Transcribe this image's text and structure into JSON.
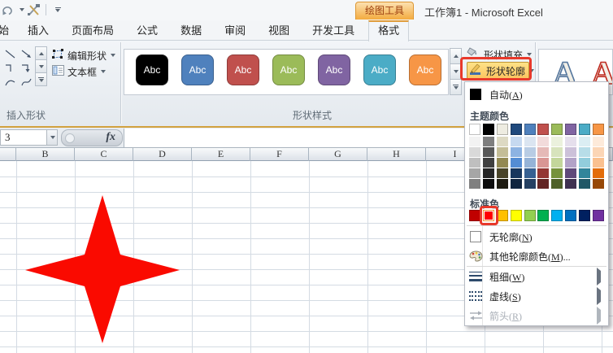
{
  "window": {
    "title": "工作簿1 - Microsoft Excel",
    "context_tool_tab": "绘图工具"
  },
  "qat": {
    "icons": [
      "redo-icon",
      "tools-icon",
      "customize-quick-access-icon"
    ]
  },
  "tabs": [
    {
      "label": "始"
    },
    {
      "label": "插入"
    },
    {
      "label": "页面布局"
    },
    {
      "label": "公式"
    },
    {
      "label": "数据"
    },
    {
      "label": "审阅"
    },
    {
      "label": "视图"
    },
    {
      "label": "开发工具"
    },
    {
      "label": "格式",
      "selected": true
    }
  ],
  "ribbon": {
    "insert_shapes": {
      "group_label": "插入形状",
      "edit_shape_label": "编辑形状",
      "text_box_label": "文本框"
    },
    "shape_styles": {
      "group_label": "形状样式",
      "tile_text": "Abc",
      "tiles": [
        {
          "fill": "#000000",
          "border": "#1a1a1a"
        },
        {
          "fill": "#4F81BD",
          "border": "#3A608E"
        },
        {
          "fill": "#C0504D",
          "border": "#8E3B39"
        },
        {
          "fill": "#9BBB59",
          "border": "#748B42"
        },
        {
          "fill": "#8064A2",
          "border": "#5F4A78"
        },
        {
          "fill": "#4BACC6",
          "border": "#387F93"
        },
        {
          "fill": "#F79646",
          "border": "#B86E33"
        }
      ]
    },
    "shape_fill_label": "形状填充",
    "shape_outline_label": "形状轮廓",
    "wordart": {
      "letters": [
        {
          "char": "A",
          "stroke": "#54769E"
        },
        {
          "char": "A",
          "stroke": "#BE2B20"
        }
      ]
    }
  },
  "formula_bar": {
    "name_box_value": "3",
    "fx_label": "fx"
  },
  "grid": {
    "column_headers": [
      "B",
      "C",
      "D",
      "E",
      "F",
      "G",
      "H",
      "I"
    ]
  },
  "shape": {
    "type": "4-point-star",
    "fill": "#FA0A00"
  },
  "outline_menu": {
    "auto_item": {
      "pre": "自动(",
      "key": "A",
      "post": ")",
      "swatch": "#000000"
    },
    "theme_colors_header": "主题颜色",
    "theme_columns": [
      {
        "main": "#FFFFFF",
        "tints": [
          "#F2F2F2",
          "#D9D9D9",
          "#BFBFBF",
          "#A6A6A6",
          "#808080"
        ]
      },
      {
        "main": "#000000",
        "tints": [
          "#7F7F7F",
          "#595959",
          "#404040",
          "#262626",
          "#0D0D0D"
        ]
      },
      {
        "main": "#EEECE1",
        "tints": [
          "#DDD9C3",
          "#C4BD97",
          "#938953",
          "#494429",
          "#1D1B10"
        ]
      },
      {
        "main": "#1F497D",
        "tints": [
          "#C6D9F0",
          "#8DB3E2",
          "#548DD4",
          "#17365D",
          "#0F243E"
        ]
      },
      {
        "main": "#4F81BD",
        "tints": [
          "#DBE5F1",
          "#B8CCE4",
          "#95B3D7",
          "#366092",
          "#244062"
        ]
      },
      {
        "main": "#C0504D",
        "tints": [
          "#F2DBDB",
          "#E5B9B7",
          "#D99694",
          "#943634",
          "#632423"
        ]
      },
      {
        "main": "#9BBB59",
        "tints": [
          "#EBF1DD",
          "#D7E3BC",
          "#C3D69B",
          "#76923C",
          "#4F6128"
        ]
      },
      {
        "main": "#8064A2",
        "tints": [
          "#E5DFEC",
          "#CCC1D9",
          "#B2A2C7",
          "#5F497A",
          "#3F3151"
        ]
      },
      {
        "main": "#4BACC6",
        "tints": [
          "#DBEEF3",
          "#B7DDE8",
          "#92CDDC",
          "#31859B",
          "#215867"
        ]
      },
      {
        "main": "#F79646",
        "tints": [
          "#FDEADA",
          "#FBD5B5",
          "#FAC08F",
          "#E36C09",
          "#974806"
        ]
      }
    ],
    "standard_colors_header": "标准色",
    "standard_colors": [
      "#C00000",
      "#FF0000",
      "#FFC000",
      "#FFFF00",
      "#92D050",
      "#00B050",
      "#00B0F0",
      "#0070C0",
      "#002060",
      "#7030A0"
    ],
    "highlighted_standard_index": 1,
    "items": [
      {
        "name": "no-outline",
        "icon": "no-outline-swatch",
        "pre": "无轮廓(",
        "key": "N",
        "post": ")"
      },
      {
        "name": "more-outline-colors",
        "icon": "palette-icon",
        "pre": "其他轮廓颜色(",
        "key": "M",
        "post": ")...",
        "separator_after": true
      },
      {
        "name": "weight",
        "icon": "weight-icon",
        "pre": "粗细(",
        "key": "W",
        "post": ")",
        "submenu": true
      },
      {
        "name": "dashes",
        "icon": "dashes-icon",
        "pre": "虚线(",
        "key": "S",
        "post": ")",
        "submenu": true
      },
      {
        "name": "arrows",
        "icon": "arrows-icon",
        "pre": "箭头(",
        "key": "R",
        "post": ")",
        "submenu": true,
        "disabled": true
      }
    ],
    "annotation_color": "#E8392B"
  }
}
